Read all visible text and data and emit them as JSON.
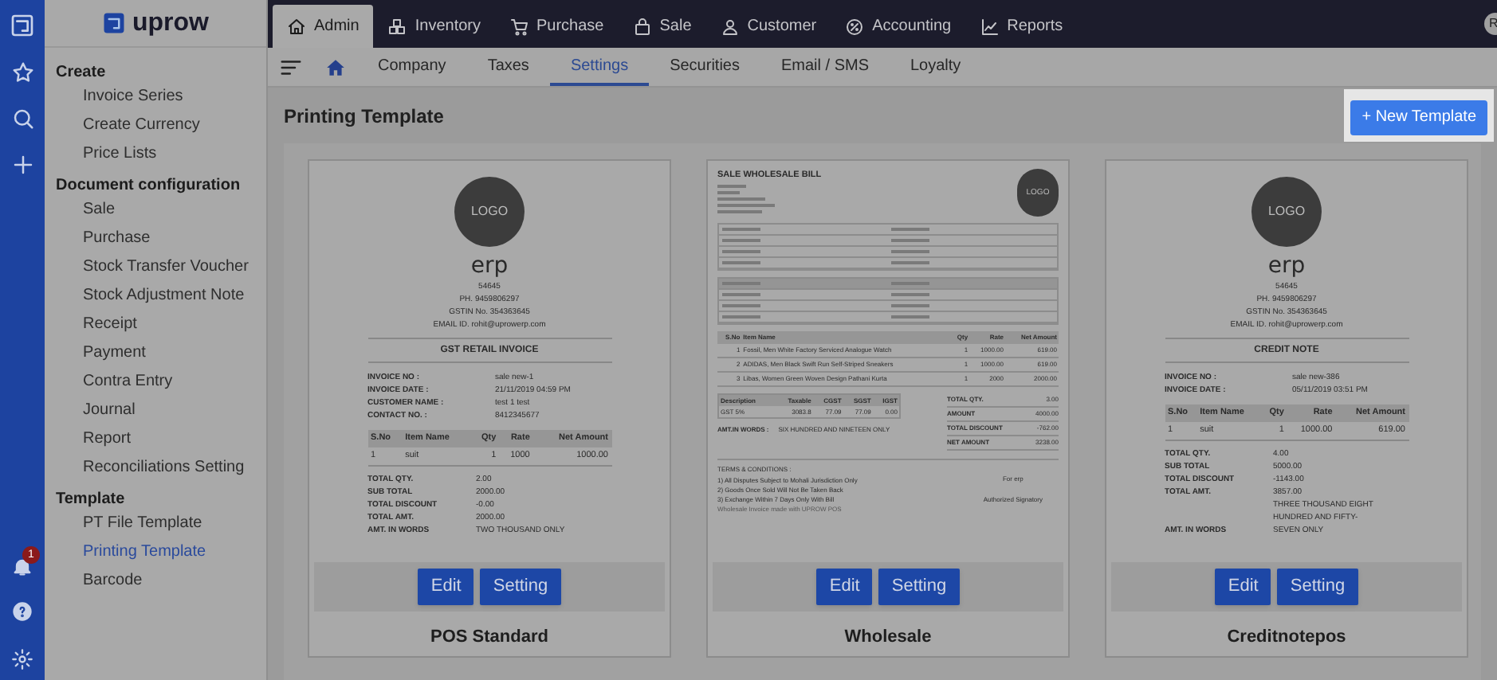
{
  "rail": {
    "notification_count": "1"
  },
  "logo": {
    "text": "uprow"
  },
  "top_tabs": [
    {
      "label": "Admin",
      "selected": true
    },
    {
      "label": "Inventory",
      "selected": false
    },
    {
      "label": "Purchase",
      "selected": false
    },
    {
      "label": "Sale",
      "selected": false
    },
    {
      "label": "Customer",
      "selected": false
    },
    {
      "label": "Accounting",
      "selected": false
    },
    {
      "label": "Reports",
      "selected": false
    }
  ],
  "avatar": {
    "initial": "R"
  },
  "sub_tabs": [
    {
      "label": "Company",
      "selected": false
    },
    {
      "label": "Taxes",
      "selected": false
    },
    {
      "label": "Settings",
      "selected": true
    },
    {
      "label": "Securities",
      "selected": false
    },
    {
      "label": "Email / SMS",
      "selected": false
    },
    {
      "label": "Loyalty",
      "selected": false
    }
  ],
  "sidebar": {
    "sections": [
      {
        "title": "Create",
        "items": [
          {
            "label": "Invoice Series",
            "selected": false
          },
          {
            "label": "Create Currency",
            "selected": false
          },
          {
            "label": "Price Lists",
            "selected": false
          }
        ]
      },
      {
        "title": "Document configuration",
        "items": [
          {
            "label": "Sale",
            "selected": false
          },
          {
            "label": "Purchase",
            "selected": false
          },
          {
            "label": "Stock Transfer Voucher",
            "selected": false
          },
          {
            "label": "Stock Adjustment Note",
            "selected": false
          },
          {
            "label": "Receipt",
            "selected": false
          },
          {
            "label": "Payment",
            "selected": false
          },
          {
            "label": "Contra Entry",
            "selected": false
          },
          {
            "label": "Journal",
            "selected": false
          },
          {
            "label": "Report",
            "selected": false
          },
          {
            "label": "Reconciliations Setting",
            "selected": false
          }
        ]
      },
      {
        "title": "Template",
        "items": [
          {
            "label": "PT File Template",
            "selected": false
          },
          {
            "label": "Printing Template",
            "selected": true
          },
          {
            "label": "Barcode",
            "selected": false
          }
        ]
      }
    ]
  },
  "page_title": "Printing Template",
  "new_template_button": "+ New Template",
  "templates": [
    {
      "kind": "receipt",
      "name": "POS Standard",
      "edit_label": "Edit",
      "setting_label": "Setting",
      "preview": {
        "logo": "LOGO",
        "company": "erp",
        "lines": [
          "54645",
          "PH. 9459806297",
          "GSTIN No. 354363645",
          "EMAIL ID. rohit@uprowerp.com"
        ],
        "doc_title": "GST RETAIL INVOICE",
        "info": [
          {
            "label": "INVOICE NO :",
            "value": "sale new-1"
          },
          {
            "label": "INVOICE DATE :",
            "value": "21/11/2019 04:59 PM"
          },
          {
            "label": "CUSTOMER NAME :",
            "value": "test 1 test"
          },
          {
            "label": "CONTACT NO. :",
            "value": "8412345677"
          }
        ],
        "columns": [
          "S.No",
          "Item Name",
          "Qty",
          "Rate",
          "Net Amount"
        ],
        "rows": [
          [
            "1",
            "suit",
            "1",
            "1000",
            "1000.00"
          ]
        ],
        "totals": [
          {
            "label": "TOTAL QTY.",
            "value": "2.00"
          },
          {
            "label": "SUB TOTAL",
            "value": "2000.00"
          },
          {
            "label": "TOTAL DISCOUNT",
            "value": "-0.00"
          },
          {
            "label": "TOTAL AMT.",
            "value": "2000.00"
          },
          {
            "label": "AMT. IN WORDS",
            "value": "TWO THOUSAND ONLY"
          }
        ]
      }
    },
    {
      "kind": "wholesale",
      "name": "Wholesale",
      "edit_label": "Edit",
      "setting_label": "Setting",
      "preview": {
        "logo": "LOGO",
        "doc_title": "SALE WHOLESALE BILL",
        "columns": [
          "S.No",
          "Item Name",
          "Qty",
          "Rate",
          "Net Amount"
        ],
        "rows": [
          [
            "1",
            "Fossil, Men White Factory Serviced Analogue Watch",
            "1",
            "1000.00",
            "619.00"
          ],
          [
            "2",
            "ADIDAS, Men Black Swift Run Self-Striped Sneakers",
            "1",
            "1000.00",
            "619.00"
          ],
          [
            "3",
            "Libas, Women Green Woven Design Pathani Kurta",
            "1",
            "2000",
            "2000.00"
          ]
        ],
        "tax_columns": [
          "Description",
          "Taxable",
          "CGST",
          "SGST",
          "IGST"
        ],
        "tax_rows": [
          [
            "GST 5%",
            "3083.8",
            "77.09",
            "77.09",
            "0.00"
          ]
        ],
        "totals": [
          {
            "label": "TOTAL QTY.",
            "value": "3.00"
          },
          {
            "label": "AMOUNT",
            "value": "4000.00"
          },
          {
            "label": "TOTAL DISCOUNT",
            "value": "-762.00"
          },
          {
            "label": "NET AMOUNT",
            "value": "3238.00"
          }
        ],
        "words_label": "AMT.IN WORDS :",
        "words_value": "SIX HUNDRED AND NINETEEN ONLY",
        "terms": [
          "TERMS & CONDITIONS :",
          "1) All Disputes Subject to Mohali Jurisdiction Only",
          "2) Goods Once Sold Will Not Be Taken Back",
          "3) Exchange Within 7 Days Only With Bill"
        ],
        "footer_note": "Wholesale Invoice made with UPROW POS",
        "for_label": "For erp",
        "signatory": "Authorized Signatory"
      }
    },
    {
      "kind": "receipt",
      "name": "Creditnotepos",
      "edit_label": "Edit",
      "setting_label": "Setting",
      "preview": {
        "logo": "LOGO",
        "company": "erp",
        "lines": [
          "54645",
          "PH. 9459806297",
          "GSTIN No. 354363645",
          "EMAIL ID. rohit@uprowerp.com"
        ],
        "doc_title": "CREDIT NOTE",
        "info": [
          {
            "label": "INVOICE NO :",
            "value": "sale new-386"
          },
          {
            "label": "INVOICE DATE :",
            "value": "05/11/2019 03:51 PM"
          }
        ],
        "columns": [
          "S.No",
          "Item Name",
          "Qty",
          "Rate",
          "Net Amount"
        ],
        "rows": [
          [
            "1",
            "suit",
            "1",
            "1000.00",
            "619.00"
          ]
        ],
        "totals": [
          {
            "label": "TOTAL QTY.",
            "value": "4.00"
          },
          {
            "label": "SUB TOTAL",
            "value": "5000.00"
          },
          {
            "label": "TOTAL DISCOUNT",
            "value": "-1143.00"
          },
          {
            "label": "TOTAL AMT.",
            "value": "3857.00"
          },
          {
            "label": "AMT. IN WORDS",
            "value": "THREE THOUSAND EIGHT HUNDRED AND FIFTY-SEVEN ONLY"
          }
        ]
      }
    }
  ]
}
